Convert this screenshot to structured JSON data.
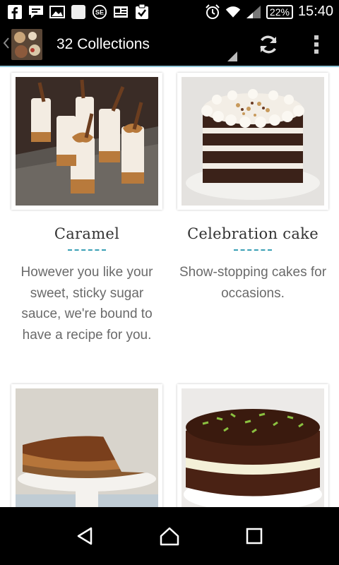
{
  "status_bar": {
    "battery": "22%",
    "time": "15:40",
    "left_icons": [
      "facebook-icon",
      "chat-icon",
      "gallery-icon",
      "blank-app-icon",
      "sf-icon",
      "news-icon",
      "clipboard-check-icon"
    ],
    "right_icons": [
      "alarm-icon",
      "wifi-icon",
      "signal-icon"
    ]
  },
  "action_bar": {
    "title": "32 Collections",
    "refresh_icon": "refresh-icon",
    "overflow_icon": "overflow-menu-icon"
  },
  "collections": [
    {
      "title": "Caramel",
      "description": "However you like your sweet, sticky sugar sauce, we're bound to have a recipe for you."
    },
    {
      "title": "Celebration cake",
      "description": "Show-stopping cakes for occasions."
    },
    {
      "title": "",
      "description": ""
    },
    {
      "title": "",
      "description": ""
    }
  ],
  "nav_bar": {
    "back_icon": "back-icon",
    "home_icon": "home-icon",
    "recents_icon": "recents-icon"
  },
  "colors": {
    "accent": "#3aa0b5",
    "bar_bg": "#000000",
    "text_title": "#333333",
    "text_desc": "#6a6a6a"
  }
}
